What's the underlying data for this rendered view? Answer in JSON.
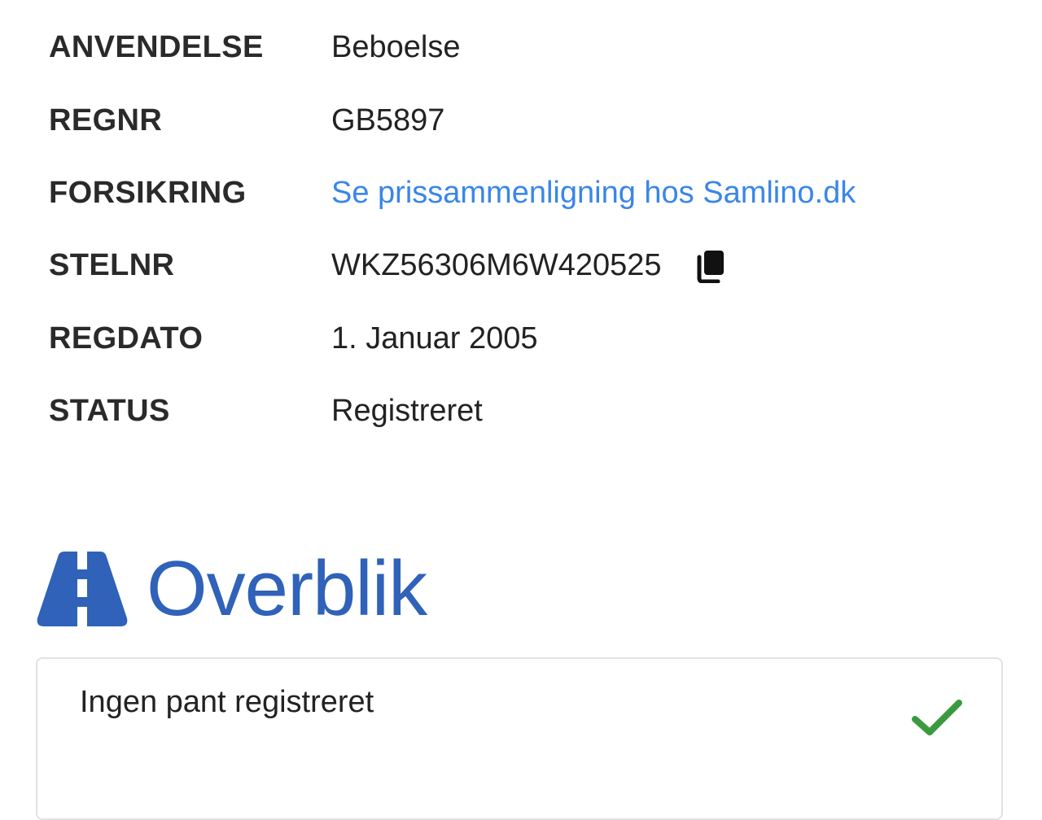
{
  "details": {
    "rows": [
      {
        "label": "ANVENDELSE",
        "value": "Beboelse"
      },
      {
        "label": "REGNR",
        "value": "GB5897"
      },
      {
        "label": "FORSIKRING",
        "value": "Se prissammenligning hos Samlino.dk"
      },
      {
        "label": "STELNR",
        "value": "WKZ56306M6W420525"
      },
      {
        "label": "REGDATO",
        "value": "1. Januar 2005"
      },
      {
        "label": "STATUS",
        "value": "Registreret"
      }
    ],
    "copy_icon": "copy-icon"
  },
  "overview": {
    "icon": "road-icon",
    "title": "Overblik"
  },
  "card": {
    "text": "Ingen pant registreret",
    "icon": "check-icon",
    "check_color": "#3a9a3e"
  },
  "colors": {
    "link": "#3a86e8",
    "brand": "#2f62b8"
  }
}
